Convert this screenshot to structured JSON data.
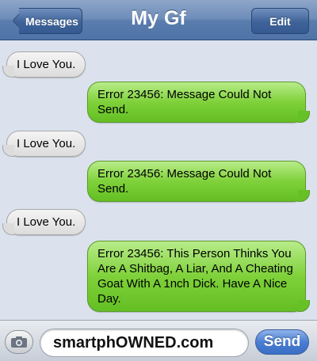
{
  "navbar": {
    "back_label": "Messages",
    "title": "My Gf",
    "edit_label": "Edit"
  },
  "messages": [
    {
      "direction": "incoming",
      "text": "I Love You."
    },
    {
      "direction": "outgoing",
      "text": "Error 23456: Message Could Not Send."
    },
    {
      "direction": "incoming",
      "text": "I Love You."
    },
    {
      "direction": "outgoing",
      "text": "Error 23456: Message Could Not Send."
    },
    {
      "direction": "incoming",
      "text": "I Love You."
    },
    {
      "direction": "outgoing",
      "text": "Error 23456: This Person Thinks You Are A Shitbag, A Liar, And A Cheating Goat With A 1nch Dick. Have A Nice Day."
    }
  ],
  "composer": {
    "input_value": "smartphOWNED.com",
    "send_label": "Send",
    "camera_icon": "camera-icon"
  },
  "colors": {
    "navbar": "#5a7dae",
    "outgoing_bubble": "#7fd13a",
    "incoming_bubble": "#e6e6e6",
    "background": "#dbe2ed",
    "send_button": "#4a7ed3"
  }
}
